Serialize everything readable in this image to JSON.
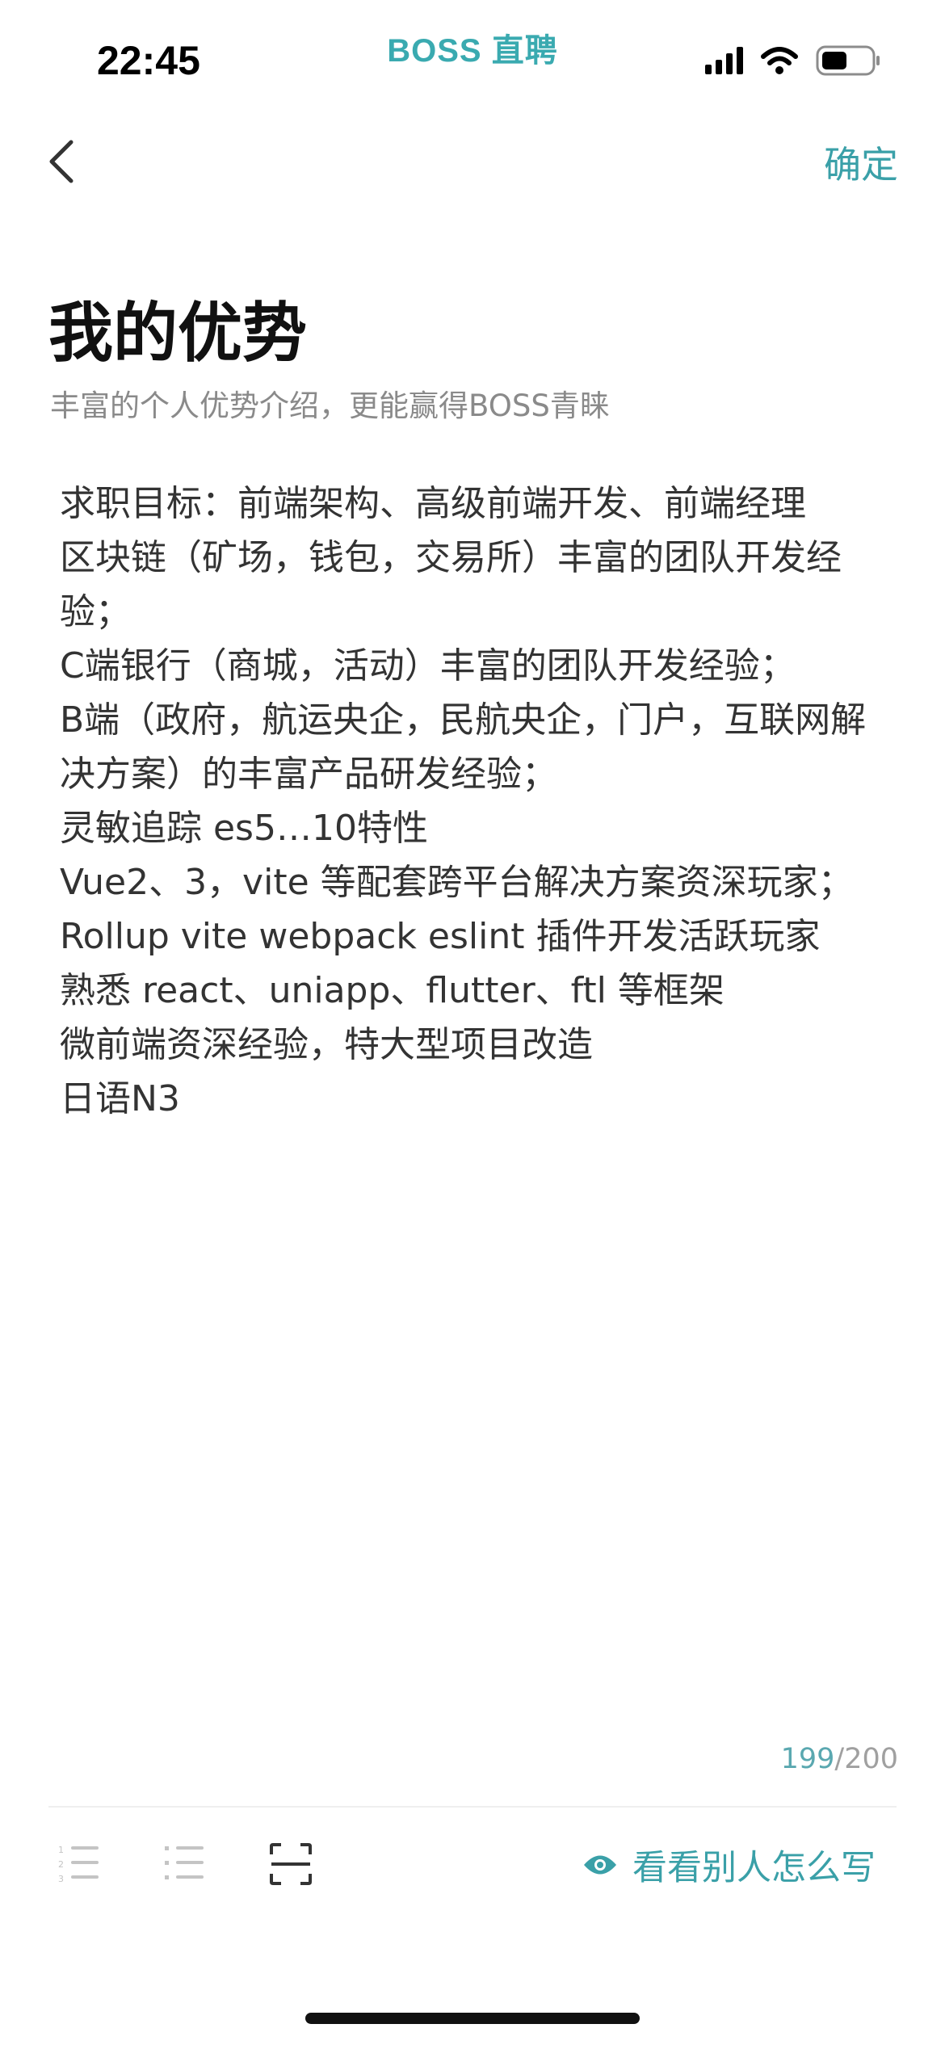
{
  "status_bar": {
    "time": "22:45",
    "brand": "BOSS 直聘"
  },
  "nav": {
    "confirm_label": "确定"
  },
  "header": {
    "title": "我的优势",
    "subtitle": "丰富的个人优势介绍，更能赢得BOSS青睐"
  },
  "content": {
    "lines": [
      "求职目标：前端架构、高级前端开发、前端经理",
      "区块链（矿场，钱包，交易所）丰富的团队开发经验；",
      "C端银行（商城，活动）丰富的团队开发经验；",
      "B端（政府，航运央企，民航央企，门户，互联网解决方案）的丰富产品研发经验；",
      "灵敏追踪 es5…10特性",
      "Vue2、3，vite  等配套跨平台解决方案资深玩家；",
      "Rollup vite webpack eslint  插件开发活跃玩家",
      "熟悉 react、uniapp、flutter、ftl 等框架",
      "微前端资深经验，特大型项目改造",
      "日语N3"
    ]
  },
  "counter": {
    "current": "199",
    "separator": "/",
    "max": "200"
  },
  "toolbar": {
    "view_others_label": "看看别人怎么写"
  },
  "colors": {
    "accent": "#3aa0a8",
    "brand": "#3aaab0"
  }
}
